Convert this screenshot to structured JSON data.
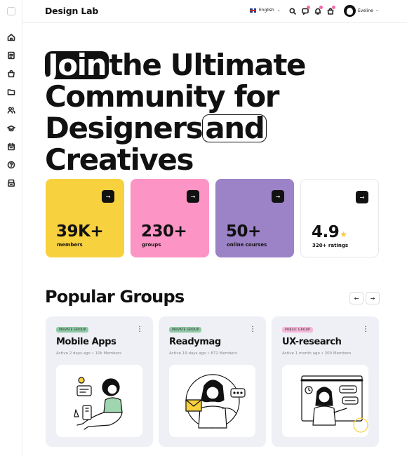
{
  "app": {
    "brand": "Design Lab"
  },
  "header": {
    "language": "English",
    "user_name": "Eveline",
    "icons": [
      "search-icon",
      "chat-icon",
      "bell-icon",
      "bag-icon"
    ]
  },
  "sidebar": {
    "items": [
      "home-icon",
      "document-icon",
      "bag-icon",
      "folder-icon",
      "users-icon",
      "graduation-cap-icon",
      "calendar-icon",
      "help-icon",
      "archive-icon"
    ]
  },
  "hero": {
    "line1_highlight": "Join",
    "line1_rest": "the Ultimate",
    "line2": "Community for",
    "line3_start": "Designers",
    "line3_highlight": "and",
    "line4": "Creatives"
  },
  "stats": [
    {
      "value": "39K+",
      "label": "members",
      "color": "#f8d13f"
    },
    {
      "value": "230+",
      "label": "groups",
      "color": "#fc94c5"
    },
    {
      "value": "50+",
      "label": "online courses",
      "color": "#9c82c6"
    },
    {
      "value": "4.9",
      "label": "320+ ratings",
      "color": "#ffffff"
    }
  ],
  "groups_section": {
    "title": "Popular Groups",
    "items": [
      {
        "badge": "PRIVATE GROUP",
        "title": "Mobile Apps",
        "meta": "Active 2 days ago  •  10k Members"
      },
      {
        "badge": "PRIVATE GROUP",
        "title": "Readymag",
        "meta": "Active 19 days ago  •  872 Members"
      },
      {
        "badge": "PUBLIC GROUP",
        "title": "UX-research",
        "meta": "Active 1 month ago  •  300 Members"
      }
    ]
  },
  "colors": {
    "accent_yellow": "#f8d13f",
    "accent_pink": "#fc94c5",
    "accent_purple": "#9c82c6",
    "notification": "#f46aa6"
  }
}
